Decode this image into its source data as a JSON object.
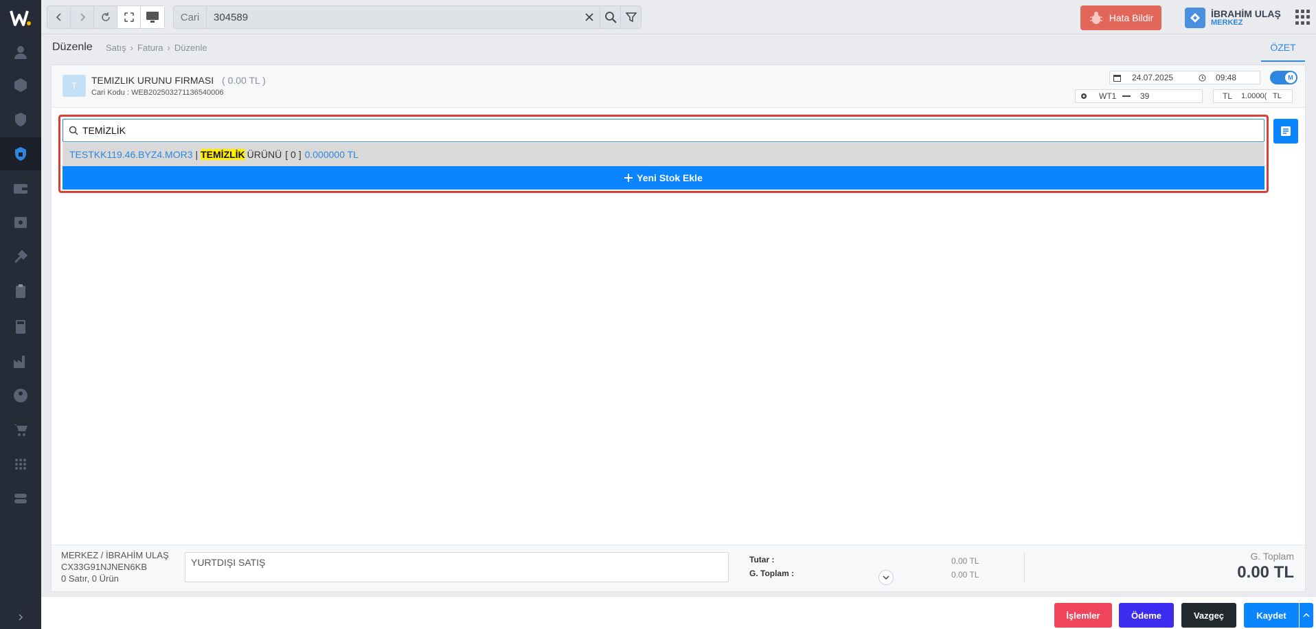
{
  "topbar": {
    "search_category": "Cari",
    "search_value": "304589",
    "bug_report_label": "Hata Bildir",
    "user_name": "İBRAHİM ULAŞ",
    "user_branch": "MERKEZ"
  },
  "page": {
    "title": "Düzenle",
    "breadcrumbs": [
      "Satış",
      "Fatura",
      "Düzenle"
    ],
    "summary_tab": "ÖZET"
  },
  "header": {
    "avatar_letter": "T",
    "firm_name": "TEMIZLIK URUNU FIRMASI",
    "firm_balance": "( 0.00 TL )",
    "firm_code": "Cari Kodu : WEB202503271136540006",
    "date": "24.07.2025",
    "time": "09:48",
    "toggle_label": "M",
    "warehouse": "WT1",
    "warehouse_value": "39",
    "currency": "TL",
    "exchange_rate": "1.0000(",
    "exchange_currency": "TL"
  },
  "stock_search": {
    "query": "TEMİZLİK",
    "result": {
      "code": "TESTKK119.46.BYZ4.MOR3",
      "separator": "|",
      "highlight": "TEMİZLİK",
      "name_rest": "ÜRÜNÜ",
      "qty": "[ 0 ]",
      "price": "0.000000 TL"
    },
    "add_stock_label": "Yeni Stok Ekle"
  },
  "footer": {
    "branch_user": "MERKEZ / İBRAHİM ULAŞ",
    "doc_code": "CX33G91NJNEN6KB",
    "row_summary": "0 Satır, 0 Ürün",
    "description": "YURTDIŞI SATIŞ",
    "amount_label": "Tutar :",
    "amount_value": "0.00 TL",
    "grand_label": "G. Toplam :",
    "grand_value": "0.00 TL",
    "grand_total_title": "G. Toplam",
    "grand_total": "0.00 TL"
  },
  "actions": {
    "operations": "İşlemler",
    "payment": "Ödeme",
    "cancel": "Vazgeç",
    "save": "Kaydet"
  },
  "colors": {
    "accent": "#0a84ff",
    "danger_frame": "#d9403a",
    "highlight": "#ffee00",
    "operations": "#f0455a",
    "payment": "#3b2cf0",
    "cancel": "#232a2e",
    "save": "#0a84ff"
  },
  "icons": {
    "rail": [
      "user-icon",
      "box-icon",
      "shield-icon",
      "invoice-icon",
      "wallet-icon",
      "safe-icon",
      "tools-icon",
      "clipboard-icon",
      "calculator-icon",
      "factory-icon",
      "person-icon",
      "cart-icon",
      "apps-icon",
      "toggle-icon"
    ]
  }
}
